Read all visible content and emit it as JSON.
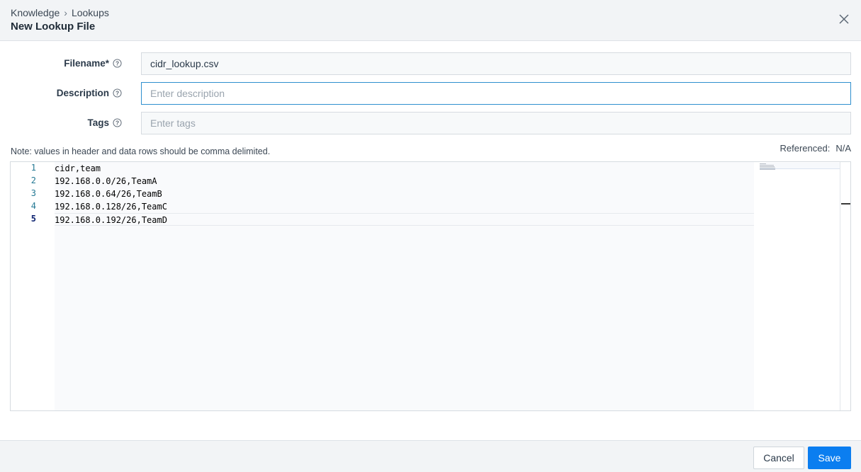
{
  "header": {
    "breadcrumb": [
      "Knowledge",
      "Lookups"
    ],
    "breadcrumb_separator": "›",
    "title": "New Lookup File",
    "close_icon": "close-icon"
  },
  "form": {
    "filename": {
      "label": "Filename*",
      "value": "cidr_lookup.csv",
      "placeholder": ""
    },
    "description": {
      "label": "Description",
      "value": "",
      "placeholder": "Enter description"
    },
    "tags": {
      "label": "Tags",
      "value": "",
      "placeholder": "Enter tags"
    }
  },
  "note": "Note: values in header and data rows should be comma delimited.",
  "referenced": {
    "label": "Referenced:",
    "value": "N/A"
  },
  "editor": {
    "line_numbers": [
      "1",
      "2",
      "3",
      "4",
      "5"
    ],
    "lines": [
      "cidr,team",
      "192.168.0.0/26,TeamA",
      "192.168.0.64/26,TeamB",
      "192.168.0.128/26,TeamC",
      "192.168.0.192/26,TeamD"
    ],
    "current_line": 5
  },
  "footer": {
    "cancel_label": "Cancel",
    "save_label": "Save"
  },
  "colors": {
    "accent": "#0b7ef0",
    "focus_border": "#2f8fce",
    "line_number": "#237893"
  }
}
